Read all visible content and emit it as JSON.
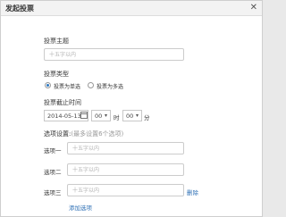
{
  "dialog": {
    "title": "发起投票",
    "close_glyph": "✕"
  },
  "topic": {
    "label": "投票主题",
    "placeholder": "十五字以内"
  },
  "type": {
    "label": "投票类型",
    "options": [
      "投票为单选",
      "投票为多选"
    ],
    "selected": "投票为单选"
  },
  "deadline": {
    "label": "投票截止时间",
    "date": "2014-05-13",
    "hour": "00",
    "hour_unit": "时",
    "minute": "00",
    "minute_unit": "分"
  },
  "options_section": {
    "label": "选项设置:",
    "hint": "(最多设置6个选项)",
    "items": [
      {
        "label": "选项一",
        "placeholder": "十五字以内"
      },
      {
        "label": "选项二",
        "placeholder": "十五字以内"
      },
      {
        "label": "选项三",
        "placeholder": "十五字以内",
        "delete": "删除"
      }
    ],
    "add_label": "添加选项"
  },
  "icons": {
    "close": "close-icon",
    "calendar": "calendar-icon",
    "dropdown": "chevron-down-icon"
  }
}
